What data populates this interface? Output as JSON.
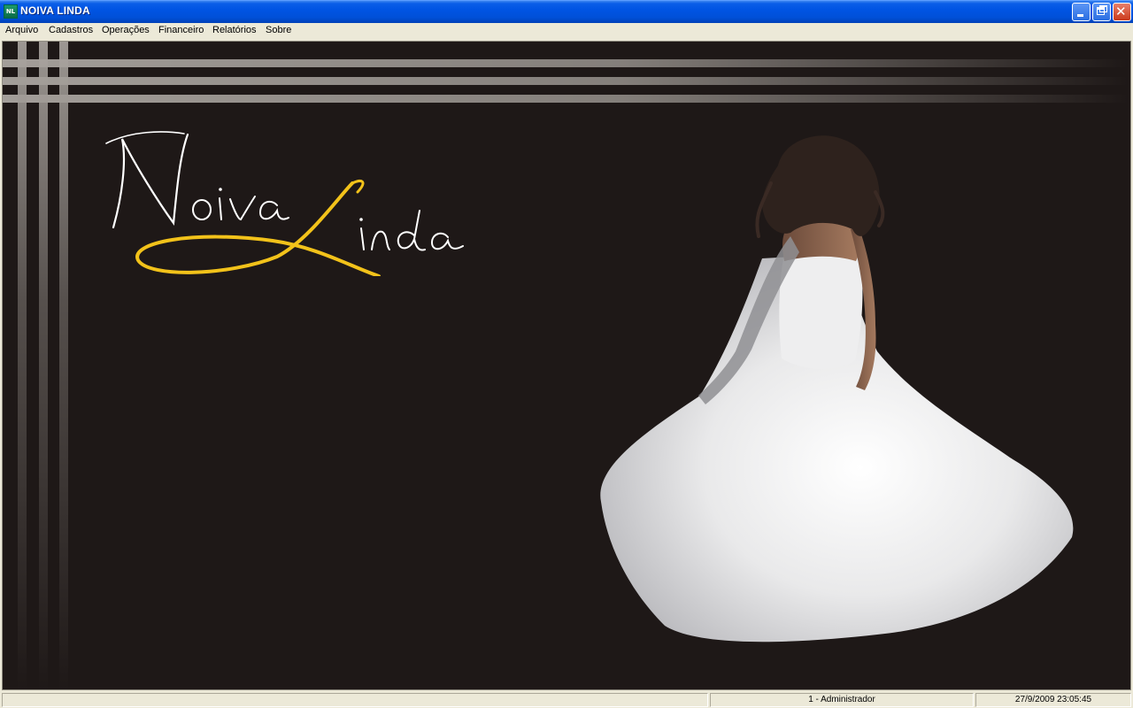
{
  "window": {
    "title": "NOIVA LINDA",
    "icon": "app-icon"
  },
  "menu": {
    "items": [
      "Arquivo",
      "Cadastros",
      "Operações",
      "Financeiro",
      "Relatórios",
      "Sobre"
    ]
  },
  "brand": {
    "logo_text": "Noiva Linda",
    "accent_color": "#f2c21a",
    "background_color": "#1e1817"
  },
  "statusbar": {
    "panels": [
      "",
      "1 - Administrador",
      "27/9/2009 23:05:45"
    ]
  }
}
